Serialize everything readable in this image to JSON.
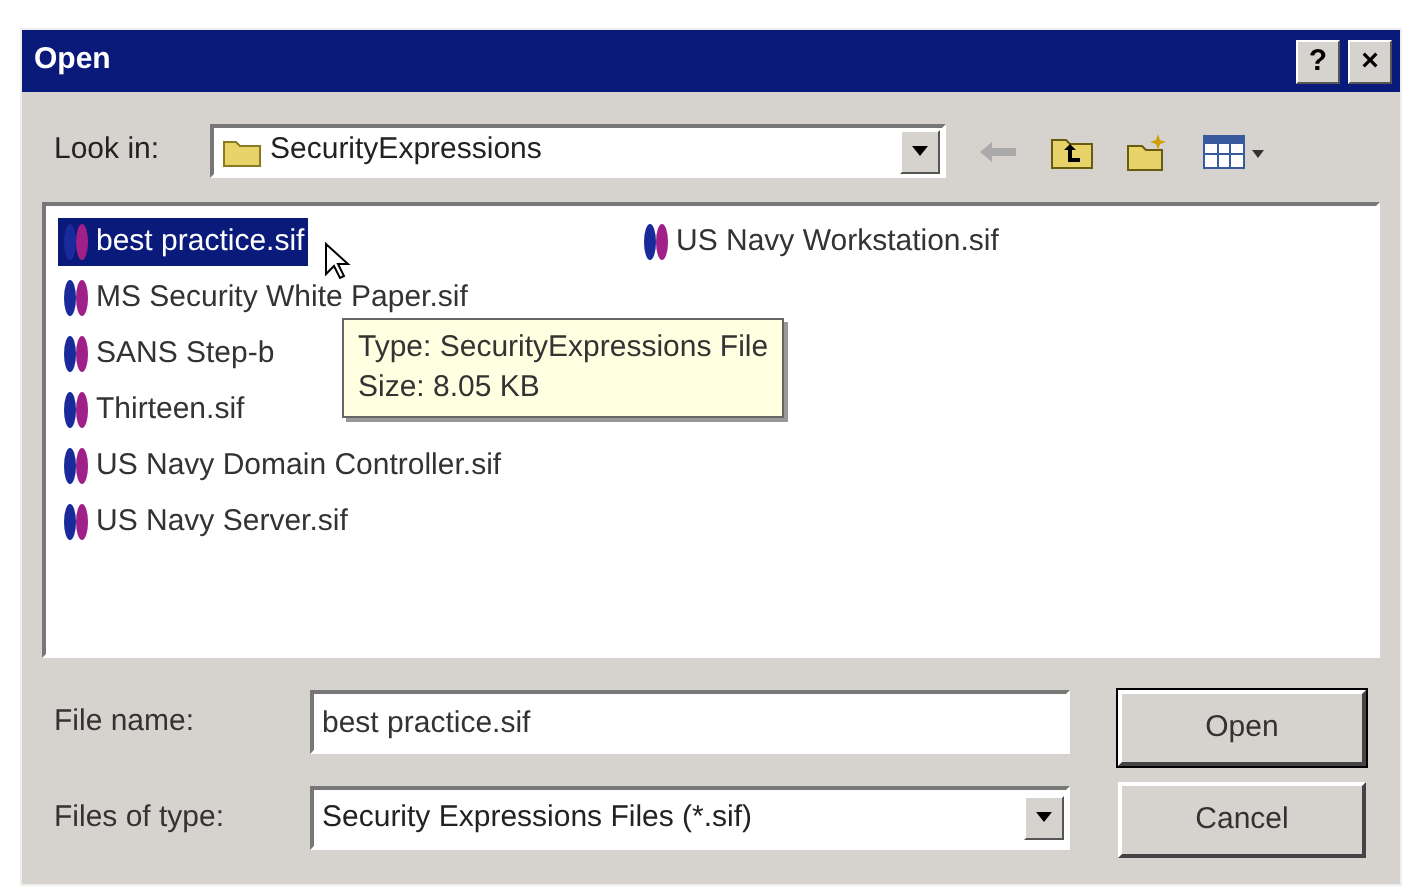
{
  "window": {
    "title": "Open",
    "buttons": [
      "?",
      "×"
    ]
  },
  "look_in": {
    "label": "Look in:",
    "value": "SecurityExpressions"
  },
  "files": [
    {
      "name": "best practice.sif",
      "selected": true
    },
    {
      "name": "MS Security White Paper.sif",
      "selected": false
    },
    {
      "name": "SANS Step-b",
      "selected": false
    },
    {
      "name": "Thirteen.sif",
      "selected": false
    },
    {
      "name": "US Navy Domain Controller.sif",
      "selected": false
    },
    {
      "name": "US Navy Server.sif",
      "selected": false
    },
    {
      "name": "US Navy Workstation.sif",
      "selected": false
    }
  ],
  "tooltip": [
    "Type: SecurityExpressions File",
    "Size: 8.05 KB"
  ],
  "file_name": {
    "label": "File name:",
    "value": "best practice.sif"
  },
  "file_type": {
    "label": "Files of type:",
    "value": "Security Expressions Files (*.sif)"
  },
  "buttons": [
    "Open",
    "Cancel"
  ]
}
